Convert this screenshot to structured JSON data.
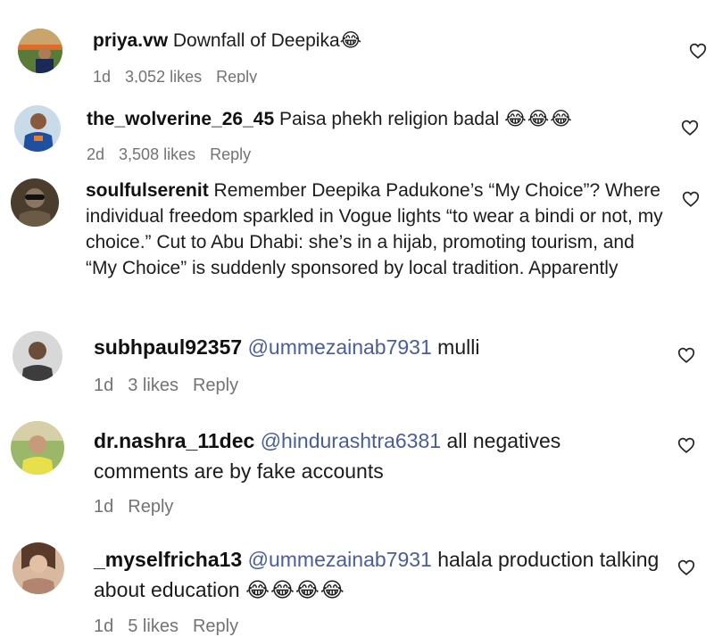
{
  "comments": [
    {
      "username": "priya.vw",
      "mention": "",
      "text": "Downfall of Deepika",
      "emojis": "😂",
      "time": "1d",
      "likes": "3,052 likes",
      "reply": "Reply"
    },
    {
      "username": "the_wolverine_26_45",
      "mention": "",
      "text": "Paisa phekh religion badal",
      "emojis": "😂😂😂",
      "time": "2d",
      "likes": "3,508 likes",
      "reply": "Reply"
    },
    {
      "username": "soulfulserenit",
      "mention": "",
      "text": "Remember Deepika Padukone’s “My Choice”? Where individual freedom sparkled in Vogue lights “to wear a bindi or not, my choice.” Cut to Abu Dhabi: she’s in a hijab, promoting tourism, and “My Choice” is suddenly sponsored by local tradition. Apparently",
      "emojis": "",
      "time": "",
      "likes": "",
      "reply": ""
    },
    {
      "username": "subhpaul92357",
      "mention": "@ummezainab7931",
      "text": "mulli",
      "emojis": "",
      "time": "1d",
      "likes": "3 likes",
      "reply": "Reply"
    },
    {
      "username": "dr.nashra_11dec",
      "mention": "@hindurashtra6381",
      "text": "all negatives comments are by fake accounts",
      "emojis": "",
      "time": "1d",
      "likes": "",
      "reply": "Reply"
    },
    {
      "username": "_myselfricha13",
      "mention": "@ummezainab7931",
      "text": "halala production talking about education",
      "emojis": "😂😂😂😂",
      "time": "1d",
      "likes": "5 likes",
      "reply": "Reply"
    }
  ],
  "colors": {
    "username": "#111111",
    "mention": "#4a5d9a",
    "meta": "#737373",
    "heart_stroke": "#262626"
  },
  "icons": {
    "like": "heart-outline-icon",
    "avatar": "profile-avatar"
  }
}
